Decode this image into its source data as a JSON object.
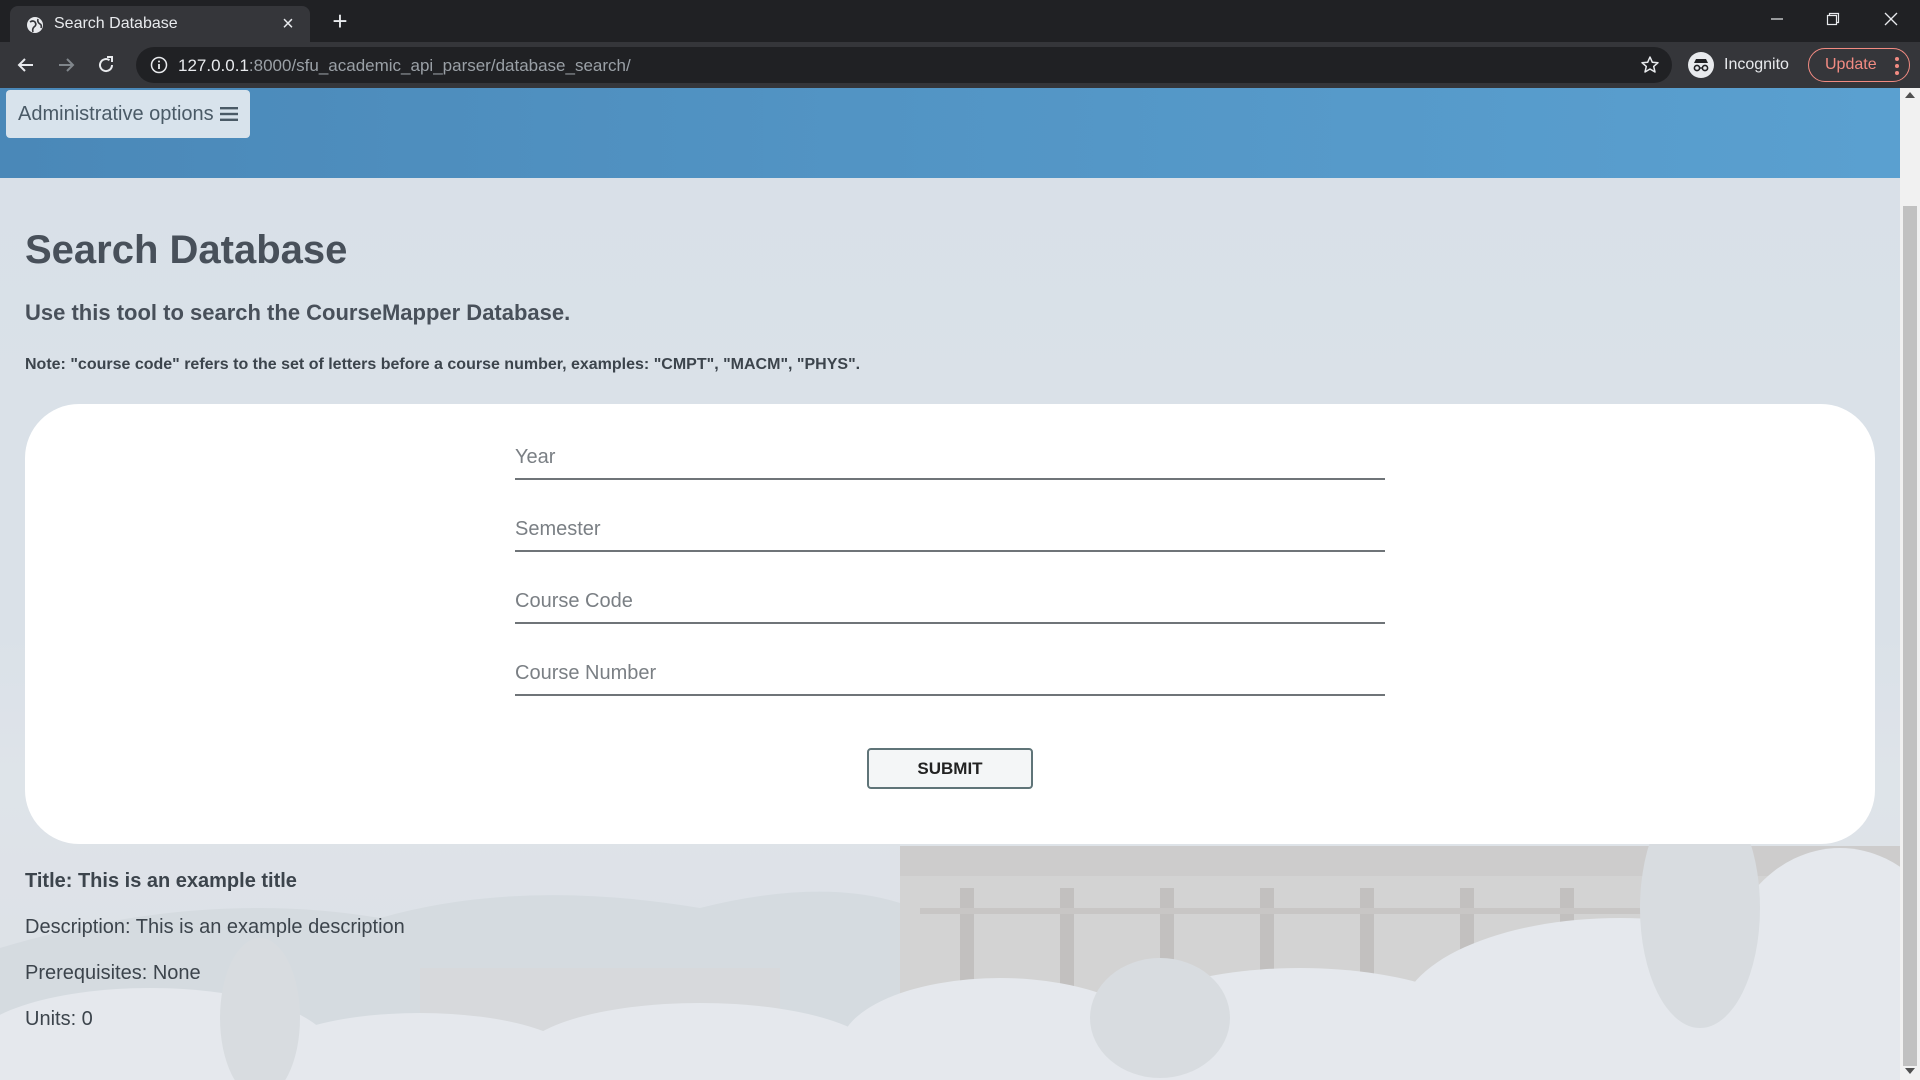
{
  "browser": {
    "tab": {
      "title": "Search Database"
    },
    "url": {
      "host": "127.0.0.1",
      "path": ":8000/sfu_academic_api_parser/database_search/"
    },
    "profile_label": "Incognito",
    "update_label": "Update"
  },
  "page": {
    "admin_button_label": "Administrative options",
    "title": "Search Database",
    "subtitle": "Use this tool to search the CourseMapper Database.",
    "note": "Note: \"course code\" refers to the set of letters before a course number, examples: \"CMPT\", \"MACM\", \"PHYS\".",
    "form": {
      "year_placeholder": "Year",
      "semester_placeholder": "Semester",
      "course_code_placeholder": "Course Code",
      "course_number_placeholder": "Course Number",
      "submit_label": "SUBMIT"
    },
    "result": {
      "title": "Title: This is an example title",
      "description": "Description: This is an example description",
      "prerequisites": "Prerequisites: None",
      "units": "Units: 0"
    }
  }
}
